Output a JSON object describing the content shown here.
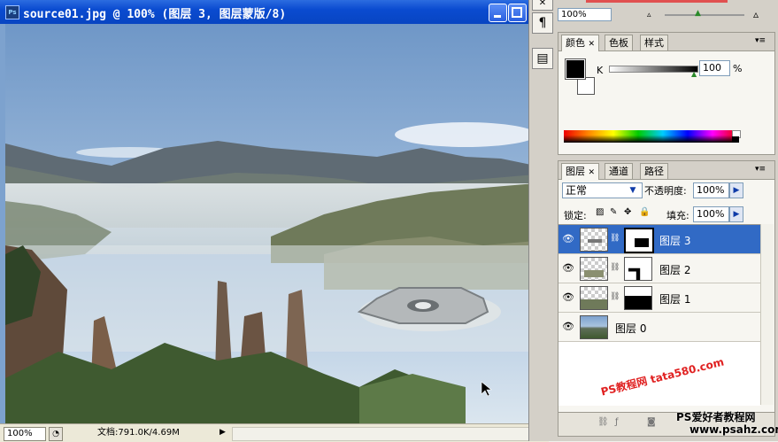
{
  "document": {
    "title": "source01.jpg @ 100% (图层 3, 图层蒙版/8)",
    "zoom": "100%",
    "doc_info": "文档:791.0K/4.69M"
  },
  "navigator": {
    "zoom": "100%"
  },
  "color_panel": {
    "tabs": [
      "颜色",
      "色板",
      "样式"
    ],
    "channel": "K",
    "value": "100",
    "unit": "%"
  },
  "layers_panel": {
    "tabs": [
      "图层",
      "通道",
      "路径"
    ],
    "blend_mode": "正常",
    "opacity_label": "不透明度:",
    "opacity": "100%",
    "lock_label": "锁定:",
    "fill_label": "填充:",
    "fill": "100%",
    "layers": [
      {
        "name": "图层 3",
        "selected": true
      },
      {
        "name": "图层 2",
        "selected": false
      },
      {
        "name": "图层 1",
        "selected": false
      },
      {
        "name": "图层 0",
        "selected": false
      }
    ]
  },
  "watermark": {
    "line1": "PS爱好者教程网",
    "line2": "www.psahz.com",
    "line3": "PS教程网 tata580.com"
  },
  "colors": {
    "title_bar": "#0a4bd0",
    "selection": "#316ac5"
  }
}
